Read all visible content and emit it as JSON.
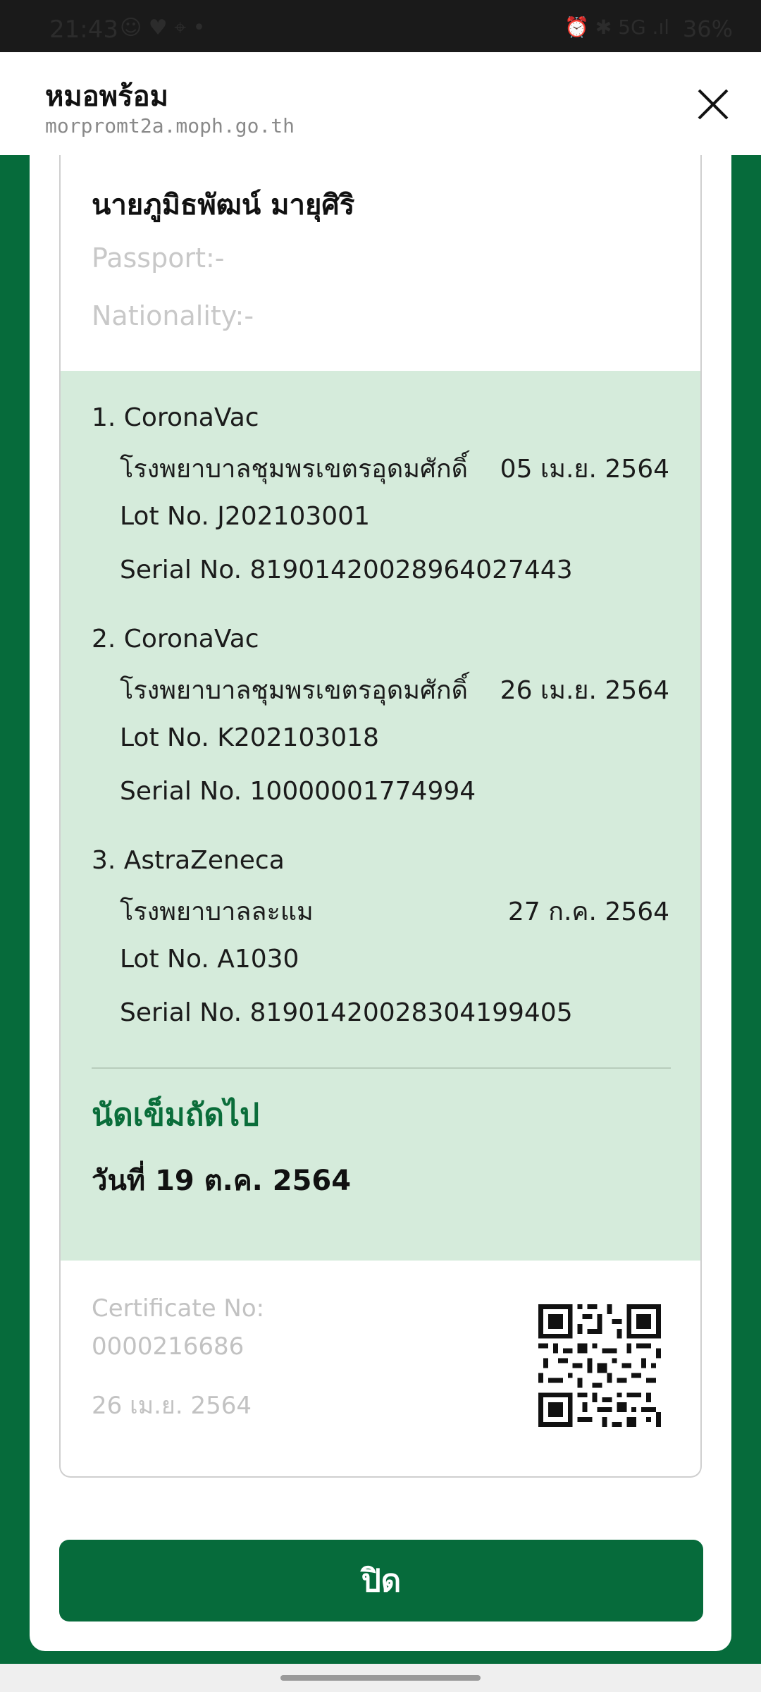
{
  "status_bar": {
    "time": "21:43",
    "left_icons": "☺ ♥ ⌖ •",
    "right_icons": "⏰ ✱ 5G .ıl",
    "battery": "36%"
  },
  "browser": {
    "site_title": "หมอพร้อม",
    "site_url": "morpromt2a.moph.go.th"
  },
  "person": {
    "name": "นายภูมิธพัฒน์ มายุศิริ",
    "passport": "Passport:-",
    "nationality": "Nationality:-"
  },
  "doses": [
    {
      "title": "1. CoronaVac",
      "hospital": "โรงพยาบาลชุมพรเขตรอุดมศักดิ์",
      "date": "05 เม.ย. 2564",
      "lot": "Lot No. J202103001",
      "serial": "Serial No. 81901420028964027443"
    },
    {
      "title": "2. CoronaVac",
      "hospital": "โรงพยาบาลชุมพรเขตรอุดมศักดิ์",
      "date": "26 เม.ย. 2564",
      "lot": "Lot No. K202103018",
      "serial": "Serial No. 10000001774994"
    },
    {
      "title": "3. AstraZeneca",
      "hospital": "โรงพยาบาลละแม",
      "date": "27 ก.ค. 2564",
      "lot": "Lot No. A1030",
      "serial": "Serial No. 81901420028304199405"
    }
  ],
  "next_appointment": {
    "label": "นัดเข็มถัดไป",
    "date": "วันที่ 19 ต.ค. 2564"
  },
  "certificate": {
    "label": "Certificate No:",
    "number": "0000216686",
    "date": "26 เม.ย. 2564"
  },
  "close_button_label": "ปิด",
  "colors": {
    "primary_green": "#066b3b",
    "panel_green": "#d5ebdb",
    "heading_green": "#0a6d3a"
  }
}
